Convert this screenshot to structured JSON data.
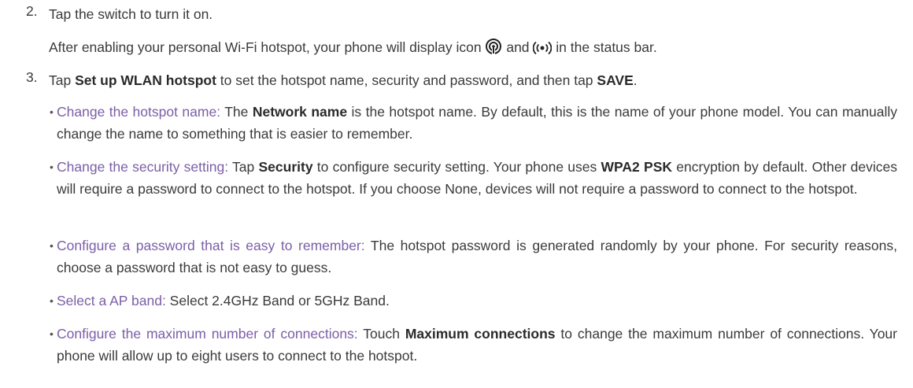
{
  "step2": {
    "number": "2.",
    "text": "Tap the switch to turn it on.",
    "sub_pre": "After enabling your personal Wi-Fi hotspot, your phone will display icon",
    "sub_mid": "and",
    "sub_post": "in the status bar.",
    "icon1": "hotspot-icon",
    "icon2": "broadcast-icon"
  },
  "step3": {
    "number": "3.",
    "text_pre": "Tap ",
    "text_bold1": "Set up WLAN hotspot",
    "text_mid": " to set the hotspot name, security and password, and then tap ",
    "text_bold2": "SAVE",
    "text_end": "."
  },
  "bullets": [
    {
      "lead": "Change the hotspot name:",
      "pre": " The ",
      "bold": "Network name",
      "post": " is the hotspot name. By default, this is the name of your phone model. You can manually change the name to something that is easier to remember."
    },
    {
      "lead": "Change the security setting:",
      "pre": " Tap ",
      "bold": "Security",
      "mid": " to configure security setting. Your phone uses ",
      "bold2": "WPA2 PSK",
      "post": " encryption by default. Other devices will require a password to connect to the hotspot. If you choose None, devices will not require a password to connect to the hotspot."
    },
    {
      "lead": "Configure a password that is easy to remember:",
      "post": " The hotspot password is generated randomly by your phone. For security reasons, choose a password that is not easy to guess."
    },
    {
      "lead": "Select a AP band:",
      "post": " Select 2.4GHz Band or 5GHz Band."
    },
    {
      "lead": "Configure the maximum number of connections:",
      "pre": " Touch ",
      "bold": "Maximum connections",
      "post": " to change the maximum number of connections. Your phone will allow up to eight users to connect to the hotspot."
    }
  ],
  "colors": {
    "lead": "#7b5ea7",
    "text": "#3a3a3a"
  }
}
